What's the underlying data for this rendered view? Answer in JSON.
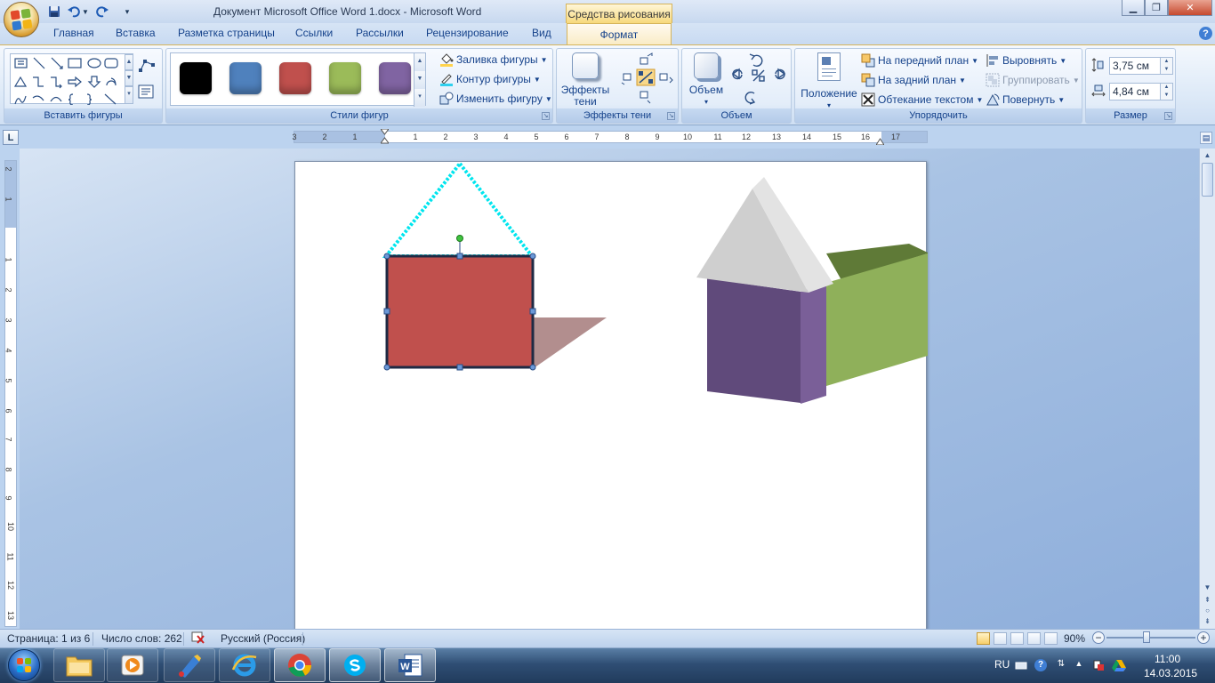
{
  "titlebar": {
    "title": "Документ Microsoft Office Word 1.docx - Microsoft Word",
    "context_tool": "Средства рисования"
  },
  "tabs": [
    "Главная",
    "Вставка",
    "Разметка страницы",
    "Ссылки",
    "Рассылки",
    "Рецензирование",
    "Вид"
  ],
  "active_tab": "Формат",
  "ribbon": {
    "insert_shapes": {
      "label": "Вставить фигуры"
    },
    "shape_styles": {
      "label": "Стили фигур",
      "swatches": [
        "#000000",
        "#4f81bd",
        "#c0504d",
        "#9bbb59",
        "#8064a2"
      ],
      "fill": "Заливка фигуры",
      "outline": "Контур фигуры",
      "change": "Изменить фигуру"
    },
    "shadow_effects": {
      "label": "Эффекты тени",
      "button_line1": "Эффекты",
      "button_line2": "тени"
    },
    "volume": {
      "label": "Объем",
      "button": "Объем"
    },
    "arrange": {
      "label": "Упорядочить",
      "position": "Положение",
      "bring_front": "На передний план",
      "send_back": "На задний план",
      "wrap": "Обтекание текстом",
      "align": "Выровнять",
      "group": "Группировать",
      "rotate": "Повернуть"
    },
    "size": {
      "label": "Размер",
      "height": "3,75 см",
      "width": "4,84 см"
    }
  },
  "hruler_labels": [
    "3",
    "2",
    "1",
    "1",
    "2",
    "3",
    "4",
    "5",
    "6",
    "7",
    "8",
    "9",
    "10",
    "11",
    "12",
    "13",
    "14",
    "15",
    "16",
    "17"
  ],
  "vruler_labels": [
    "2",
    "1",
    "1",
    "2",
    "3",
    "4",
    "5",
    "6",
    "7",
    "8",
    "9",
    "10",
    "11",
    "12",
    "13"
  ],
  "statusbar": {
    "page": "Страница: 1 из 6",
    "words": "Число слов: 262",
    "language": "Русский (Россия)",
    "zoom": "90%",
    "zoom_level": 0.45
  },
  "tray": {
    "lang": "RU",
    "time": "11:00",
    "date": "14.03.2015"
  },
  "colors": {
    "red_shape": "#c0504d",
    "purple": "#604a7b",
    "green": "#8fb05a",
    "gray_roof": "#d0d0d0",
    "selection": "#00e5ee"
  }
}
